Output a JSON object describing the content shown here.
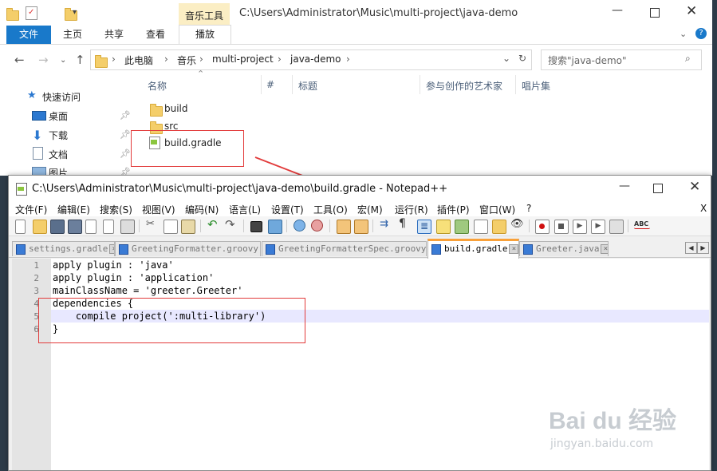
{
  "explorer": {
    "title_path": "C:\\Users\\Administrator\\Music\\multi-project\\java-demo",
    "context_tab": "音乐工具",
    "ribbon_tabs": {
      "file": "文件",
      "home": "主页",
      "share": "共享",
      "view": "查看",
      "play": "播放"
    },
    "breadcrumb": [
      "此电脑",
      "音乐",
      "multi-project",
      "java-demo"
    ],
    "search_placeholder": "搜索\"java-demo\"",
    "quick_access": {
      "label": "快速访问",
      "items": [
        "桌面",
        "下载",
        "文档",
        "图片"
      ]
    },
    "columns": {
      "name": "名称",
      "num": "#",
      "title": "标题",
      "artist": "参与创作的艺术家",
      "album": "唱片集"
    },
    "files": [
      "build",
      "src",
      "build.gradle"
    ]
  },
  "notepad": {
    "title": "C:\\Users\\Administrator\\Music\\multi-project\\java-demo\\build.gradle - Notepad++",
    "menu": [
      "文件(F)",
      "编辑(E)",
      "搜索(S)",
      "视图(V)",
      "编码(N)",
      "语言(L)",
      "设置(T)",
      "工具(O)",
      "宏(M)",
      "运行(R)",
      "插件(P)",
      "窗口(W)",
      "?"
    ],
    "menu_close": "X",
    "tabs": [
      "settings.gradle",
      "GreetingFormatter.groovy",
      "GreetingFormatterSpec.groovy",
      "build.gradle",
      "Greeter.java"
    ],
    "active_tab": 3,
    "lines": [
      {
        "n": "1",
        "text": "apply plugin : 'java'"
      },
      {
        "n": "2",
        "text": "apply plugin : 'application'"
      },
      {
        "n": "3",
        "text": "mainClassName = 'greeter.Greeter'"
      },
      {
        "n": "4",
        "text": "dependencies {"
      },
      {
        "n": "5",
        "text": "    compile project(':multi-library')"
      },
      {
        "n": "6",
        "text": "}"
      }
    ]
  },
  "colors": {
    "accent_blue": "#1979ca",
    "highlight": "#e23b3b",
    "tab_active": "#f9a13a"
  },
  "watermark": {
    "brand": "Bai du 经验",
    "url": "jingyan.baidu.com"
  }
}
